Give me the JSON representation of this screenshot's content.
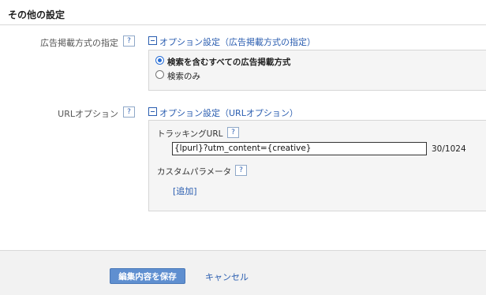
{
  "section": {
    "title": "その他の設定"
  },
  "ad_placement": {
    "label": "広告掲載方式の指定",
    "help": "?",
    "section_link": "オプション設定（広告掲載方式の指定）",
    "options": [
      {
        "label": "検索を含むすべての広告掲載方式",
        "selected": true
      },
      {
        "label": "検索のみ",
        "selected": false
      }
    ]
  },
  "url_options": {
    "label": "URLオプション",
    "help": "?",
    "section_link": "オプション設定（URLオプション）",
    "tracking_url": {
      "label": "トラッキングURL",
      "help": "?",
      "value": "{lpurl}?utm_content={creative}",
      "counter": "30/1024"
    },
    "custom_params": {
      "label": "カスタムパラメータ",
      "help": "?",
      "add_link": "[追加]"
    }
  },
  "footer": {
    "save_label": "編集内容を保存",
    "cancel_label": "キャンセル"
  },
  "colors": {
    "link": "#2a5db0",
    "button": "#5f8fd0",
    "panel_bg": "#f5f5f5"
  }
}
